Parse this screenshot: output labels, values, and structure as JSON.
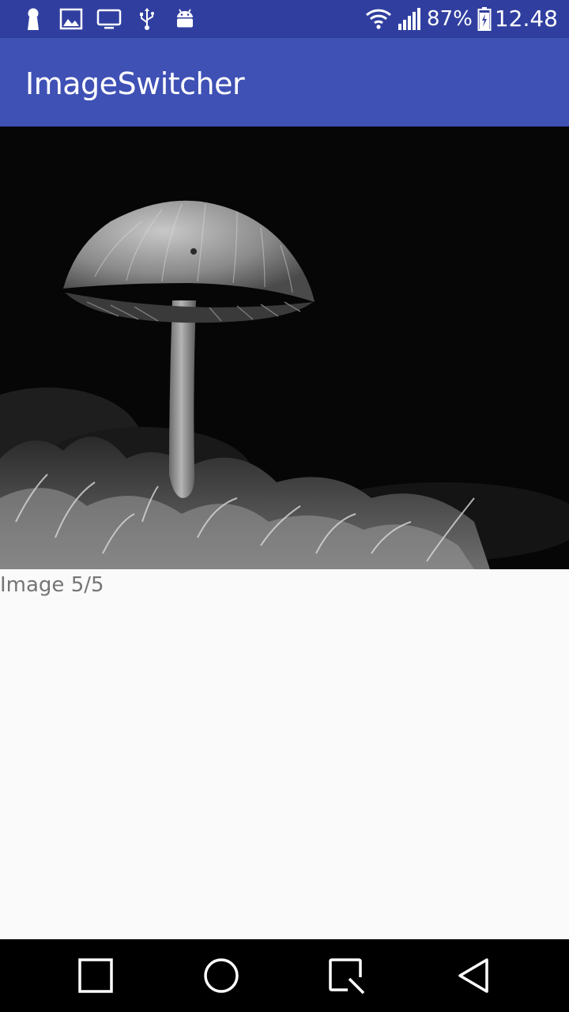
{
  "status_bar": {
    "notification_icons": [
      "keyhole-icon",
      "gallery-icon",
      "monitor-icon",
      "usb-icon",
      "android-icon"
    ],
    "wifi_icon": "wifi-icon",
    "signal_icon": "cell-signal-icon",
    "battery_percent": "87%",
    "battery_icon": "battery-charging-icon",
    "time": "12.48"
  },
  "app_bar": {
    "title": "ImageSwitcher",
    "color": "#3f51b5",
    "status_color": "#303f9f"
  },
  "image_switcher": {
    "caption": "Image 5/5"
  },
  "nav_bar": {
    "buttons": [
      "recents-button",
      "home-button",
      "screenshot-button",
      "back-button"
    ]
  }
}
